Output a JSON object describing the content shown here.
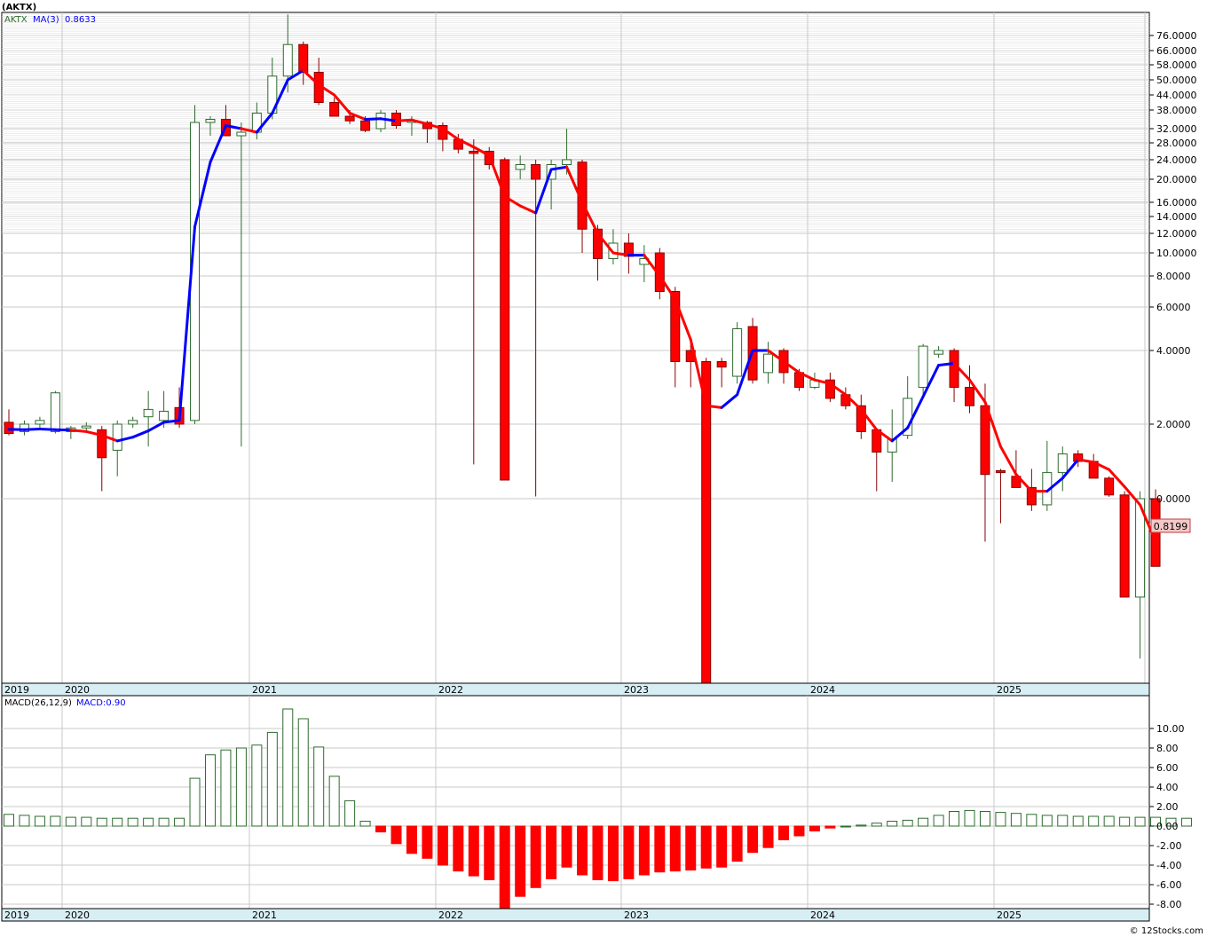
{
  "header": {
    "symbol_title": "(AKTX)",
    "legend_symbol": "AKTX",
    "legend_ma": "MA(3)",
    "legend_ma_value": "0.8633",
    "macd_label": "MACD(26,12,9)",
    "macd_value": "MACD:0.90",
    "last_price_badge": "0.8199",
    "watermark": "© 12Stocks.com"
  },
  "colors": {
    "up_candle": "#2e6b2e",
    "down_candle": "#ff0000",
    "ma_up": "#0000ff",
    "ma_down": "#ff0000",
    "grid": "#c8c8c8",
    "year_band": "#d7eef5",
    "badge_fill": "#f5c8c8"
  },
  "chart_data": [
    {
      "type": "candlestick",
      "title": "(AKTX)",
      "interval": "monthly",
      "y_scale": "nonlinear",
      "ylabels": [
        "76.0000",
        "66.0000",
        "58.0000",
        "50.0000",
        "44.0000",
        "38.0000",
        "32.0000",
        "28.0000",
        "24.0000",
        "20.0000",
        "16.0000",
        "14.0000",
        "12.0000",
        "10.0000",
        "8.0000",
        "6.0000",
        "4.0000",
        "2.0000",
        "0.0000"
      ],
      "xlabels": [
        "2019",
        "2020",
        "2021",
        "2022",
        "2023",
        "2024",
        "2025"
      ],
      "ma_period": 3,
      "last_value": 0.8199,
      "grid": true,
      "candles": [
        {
          "o": 2.05,
          "h": 2.4,
          "l": 1.7,
          "c": 1.75
        },
        {
          "o": 1.8,
          "h": 2.1,
          "l": 1.7,
          "c": 2.0
        },
        {
          "o": 2.0,
          "h": 2.2,
          "l": 1.85,
          "c": 2.1
        },
        {
          "o": 1.8,
          "h": 2.9,
          "l": 1.75,
          "c": 2.85
        },
        {
          "o": 1.8,
          "h": 1.95,
          "l": 1.6,
          "c": 1.9
        },
        {
          "o": 1.9,
          "h": 2.05,
          "l": 1.8,
          "c": 1.95
        },
        {
          "o": 1.85,
          "h": 1.95,
          "l": 0.2,
          "c": 1.1
        },
        {
          "o": 1.3,
          "h": 2.1,
          "l": 0.6,
          "c": 2.0
        },
        {
          "o": 2.0,
          "h": 2.2,
          "l": 1.9,
          "c": 2.1
        },
        {
          "o": 2.2,
          "h": 2.9,
          "l": 1.4,
          "c": 2.4
        },
        {
          "o": 2.1,
          "h": 2.9,
          "l": 1.9,
          "c": 2.35
        },
        {
          "o": 2.45,
          "h": 3.0,
          "l": 1.9,
          "c": 2.0
        },
        {
          "o": 2.1,
          "h": 40.0,
          "l": 2.0,
          "c": 34.0
        },
        {
          "o": 34.0,
          "h": 36.0,
          "l": 30.0,
          "c": 35.0
        },
        {
          "o": 35.0,
          "h": 40.0,
          "l": 30.0,
          "c": 30.0
        },
        {
          "o": 30.0,
          "h": 34.0,
          "l": 1.4,
          "c": 31.0
        },
        {
          "o": 31.0,
          "h": 41.0,
          "l": 29.0,
          "c": 37.0
        },
        {
          "o": 37.0,
          "h": 62.0,
          "l": 35.0,
          "c": 52.0
        },
        {
          "o": 52.0,
          "h": 90.0,
          "l": 45.0,
          "c": 70.0
        },
        {
          "o": 70.0,
          "h": 72.0,
          "l": 48.0,
          "c": 54.0
        },
        {
          "o": 54.0,
          "h": 62.0,
          "l": 40.0,
          "c": 41.0
        },
        {
          "o": 41.0,
          "h": 43.0,
          "l": 36.0,
          "c": 36.0
        },
        {
          "o": 36.0,
          "h": 38.0,
          "l": 33.5,
          "c": 34.5
        },
        {
          "o": 34.5,
          "h": 36.0,
          "l": 31.0,
          "c": 31.5
        },
        {
          "o": 32.0,
          "h": 38.0,
          "l": 31.0,
          "c": 37.0
        },
        {
          "o": 37.0,
          "h": 38.0,
          "l": 32.0,
          "c": 33.0
        },
        {
          "o": 34.0,
          "h": 36.0,
          "l": 30.0,
          "c": 34.5
        },
        {
          "o": 34.0,
          "h": 34.5,
          "l": 28.0,
          "c": 32.0
        },
        {
          "o": 33.0,
          "h": 34.0,
          "l": 26.0,
          "c": 29.0
        },
        {
          "o": 29.0,
          "h": 30.5,
          "l": 25.5,
          "c": 26.5
        },
        {
          "o": 26.0,
          "h": 29.0,
          "l": 0.92,
          "c": 25.5
        },
        {
          "o": 26.0,
          "h": 27.0,
          "l": 22.0,
          "c": 23.0
        },
        {
          "o": 24.0,
          "h": 24.5,
          "l": 0.5,
          "c": 0.5
        },
        {
          "o": 22.0,
          "h": 25.0,
          "l": 20.0,
          "c": 23.0
        },
        {
          "o": 23.0,
          "h": 24.0,
          "l": 0.06,
          "c": 20.0
        },
        {
          "o": 20.0,
          "h": 24.0,
          "l": 15.0,
          "c": 23.0
        },
        {
          "o": 23.0,
          "h": 32.0,
          "l": 21.0,
          "c": 24.0
        },
        {
          "o": 23.5,
          "h": 24.0,
          "l": 10.0,
          "c": 12.5
        },
        {
          "o": 12.5,
          "h": 13.0,
          "l": 7.7,
          "c": 9.5
        },
        {
          "o": 9.5,
          "h": 12.5,
          "l": 9.0,
          "c": 11.0
        },
        {
          "o": 11.0,
          "h": 12.0,
          "l": 8.2,
          "c": 9.7
        },
        {
          "o": 9.0,
          "h": 10.8,
          "l": 7.6,
          "c": 9.5
        },
        {
          "o": 10.0,
          "h": 10.5,
          "l": 6.5,
          "c": 7.0
        },
        {
          "o": 7.0,
          "h": 7.3,
          "l": 3.0,
          "c": 3.7
        },
        {
          "o": 4.0,
          "h": 4.5,
          "l": 3.0,
          "c": 3.7
        },
        {
          "o": 3.7,
          "h": 3.8,
          "l": -1.5,
          "c": -1.5
        },
        {
          "o": 3.7,
          "h": 3.8,
          "l": 3.0,
          "c": 3.55
        },
        {
          "o": 3.3,
          "h": 5.3,
          "l": 3.1,
          "c": 5.0
        },
        {
          "o": 5.1,
          "h": 5.5,
          "l": 3.1,
          "c": 3.2
        },
        {
          "o": 3.4,
          "h": 4.4,
          "l": 3.1,
          "c": 3.9
        },
        {
          "o": 4.0,
          "h": 4.1,
          "l": 3.1,
          "c": 3.4
        },
        {
          "o": 3.4,
          "h": 3.5,
          "l": 2.9,
          "c": 3.0
        },
        {
          "o": 3.0,
          "h": 3.4,
          "l": 2.95,
          "c": 3.2
        },
        {
          "o": 3.2,
          "h": 3.4,
          "l": 2.6,
          "c": 2.7
        },
        {
          "o": 2.8,
          "h": 3.0,
          "l": 2.4,
          "c": 2.5
        },
        {
          "o": 2.5,
          "h": 2.8,
          "l": 1.6,
          "c": 1.8
        },
        {
          "o": 1.85,
          "h": 1.9,
          "l": 0.2,
          "c": 1.25
        },
        {
          "o": 1.25,
          "h": 2.4,
          "l": 0.45,
          "c": 1.6
        },
        {
          "o": 1.7,
          "h": 3.3,
          "l": 1.6,
          "c": 2.7
        },
        {
          "o": 3.0,
          "h": 4.3,
          "l": 2.8,
          "c": 4.2
        },
        {
          "o": 3.9,
          "h": 4.2,
          "l": 3.8,
          "c": 4.0
        },
        {
          "o": 4.0,
          "h": 4.1,
          "l": 2.6,
          "c": 3.0
        },
        {
          "o": 3.0,
          "h": 3.6,
          "l": 2.3,
          "c": 2.5
        },
        {
          "o": 2.5,
          "h": 3.1,
          "l": -0.35,
          "c": 0.65
        },
        {
          "o": 0.75,
          "h": 0.8,
          "l": -0.2,
          "c": 0.7
        },
        {
          "o": 0.6,
          "h": 1.3,
          "l": 0.3,
          "c": 0.3
        },
        {
          "o": 0.3,
          "h": 0.8,
          "l": -0.1,
          "c": -0.05
        },
        {
          "o": -0.05,
          "h": 1.55,
          "l": -0.1,
          "c": 0.7
        },
        {
          "o": 0.7,
          "h": 1.4,
          "l": 0.2,
          "c": 1.2
        },
        {
          "o": 1.2,
          "h": 1.3,
          "l": 0.85,
          "c": 1.0
        },
        {
          "o": 1.0,
          "h": 1.2,
          "l": 0.6,
          "c": 0.55
        },
        {
          "o": 0.55,
          "h": 0.6,
          "l": 0.05,
          "c": 0.1
        },
        {
          "o": 0.1,
          "h": 0.2,
          "l": -0.8,
          "c": -0.8
        },
        {
          "o": -0.8,
          "h": 0.2,
          "l": -1.3,
          "c": 0.0
        },
        {
          "o": 0.0,
          "h": 0.25,
          "l": -0.55,
          "c": -0.55
        }
      ],
      "ma": [
        1.86,
        1.85,
        1.87,
        1.85,
        1.84,
        1.8,
        1.7,
        1.55,
        1.65,
        1.82,
        2.05,
        2.1,
        12.8,
        23.5,
        33.0,
        32.0,
        31.0,
        37.0,
        50.0,
        55.0,
        48.0,
        44.0,
        37.0,
        35.0,
        35.2,
        34.5,
        34.8,
        33.5,
        32.0,
        29.0,
        27.0,
        25.0,
        17.0,
        15.5,
        14.5,
        22.0,
        22.5,
        16.0,
        12.0,
        10.0,
        9.8,
        9.8,
        8.0,
        6.5,
        4.5,
        2.5,
        2.45,
        2.8,
        4.0,
        4.0,
        3.7,
        3.4,
        3.2,
        3.1,
        2.8,
        2.4,
        1.85,
        1.55,
        1.9,
        2.75,
        3.6,
        3.65,
        3.2,
        2.6,
        1.4,
        0.65,
        0.2,
        0.2,
        0.55,
        1.05,
        0.98,
        0.78,
        0.32,
        -0.05,
        -0.35
      ],
      "ma_colors": [
        "b",
        "b",
        "b",
        "b",
        "r",
        "r",
        "r",
        "b",
        "b",
        "b",
        "b",
        "b",
        "b",
        "b",
        "b",
        "r",
        "b",
        "b",
        "b",
        "r",
        "r",
        "r",
        "r",
        "b",
        "b",
        "r",
        "r",
        "r",
        "r",
        "r",
        "r",
        "r",
        "r",
        "r",
        "b",
        "b",
        "r",
        "r",
        "r",
        "r",
        "b",
        "r",
        "r",
        "r",
        "r",
        "r",
        "b",
        "b",
        "b",
        "r",
        "r",
        "r",
        "r",
        "r",
        "r",
        "r",
        "r",
        "b",
        "b",
        "b",
        "b",
        "r",
        "r",
        "r",
        "r",
        "r",
        "r",
        "b",
        "b",
        "r",
        "r",
        "r",
        "r",
        "r",
        "r"
      ]
    },
    {
      "type": "bar",
      "title": "MACD(26,12,9)",
      "ylabels": [
        "10.00",
        "8.00",
        "6.00",
        "4.00",
        "2.00",
        "0.00",
        "-2.00",
        "-4.00",
        "-6.00",
        "-8.00"
      ],
      "ylim": [
        -8.6,
        12.0
      ],
      "values": [
        1.2,
        1.1,
        1.0,
        1.0,
        0.9,
        0.9,
        0.8,
        0.8,
        0.8,
        0.8,
        0.8,
        0.8,
        4.9,
        7.3,
        7.8,
        8.0,
        8.3,
        9.6,
        12.0,
        11.0,
        8.1,
        5.1,
        2.6,
        0.5,
        -0.6,
        -1.8,
        -2.8,
        -3.3,
        -4.0,
        -4.6,
        -5.1,
        -5.5,
        -8.6,
        -7.2,
        -6.3,
        -5.4,
        -4.2,
        -5.0,
        -5.5,
        -5.6,
        -5.4,
        -5.0,
        -4.7,
        -4.6,
        -4.5,
        -4.3,
        -4.2,
        -3.6,
        -2.7,
        -2.2,
        -1.4,
        -1.0,
        -0.5,
        -0.2,
        0.0,
        0.1,
        0.3,
        0.5,
        0.6,
        0.8,
        1.1,
        1.5,
        1.6,
        1.5,
        1.4,
        1.3,
        1.2,
        1.1,
        1.1,
        1.0,
        1.0,
        1.0,
        0.9,
        0.9,
        0.9,
        0.8,
        0.8
      ],
      "xlabels": [
        "2019",
        "2020",
        "2021",
        "2022",
        "2023",
        "2024",
        "2025"
      ]
    }
  ]
}
